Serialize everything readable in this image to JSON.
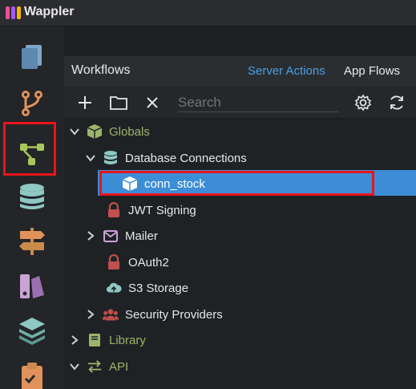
{
  "app": {
    "title": "Wappler"
  },
  "panel": {
    "title": "Workflows",
    "tab_server": "Server Actions",
    "tab_app": "App Flows",
    "search_placeholder": "Search"
  },
  "tree": {
    "globals": "Globals",
    "database_connections": "Database Connections",
    "conn_stock": "conn_stock",
    "jwt_signing": "JWT Signing",
    "mailer": "Mailer",
    "oauth2": "OAuth2",
    "s3_storage": "S3 Storage",
    "security_providers": "Security Providers",
    "library": "Library",
    "api": "API"
  },
  "colors": {
    "accent_blue": "#4a9fe8",
    "selected_row": "#3c8dd6",
    "highlight_red": "#e8141c",
    "globals_green": "#9bb56a",
    "icon_teal": "#8fc7c2"
  }
}
